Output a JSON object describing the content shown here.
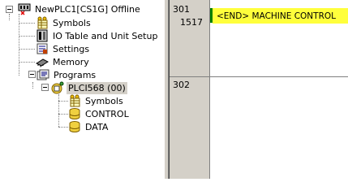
{
  "tree": {
    "root": {
      "label": "NewPLC1[CS1G] Offline",
      "icon": "plc-offline-icon"
    },
    "items": [
      {
        "label": "Symbols",
        "icon": "symbols-table-icon"
      },
      {
        "label": "IO Table and Unit Setup",
        "icon": "io-table-icon"
      },
      {
        "label": "Settings",
        "icon": "settings-icon"
      },
      {
        "label": "Memory",
        "icon": "memory-icon"
      },
      {
        "label": "Programs",
        "icon": "programs-folder-icon"
      }
    ],
    "program": {
      "label": "PLCI568 (00)",
      "icon": "program-task-icon"
    },
    "sections": [
      {
        "label": "Symbols",
        "icon": "local-symbols-icon"
      },
      {
        "label": "CONTROL",
        "icon": "section-icon"
      },
      {
        "label": "DATA",
        "icon": "section-icon"
      }
    ]
  },
  "ladder": {
    "rungs": [
      {
        "rung": "301",
        "step": "1517"
      },
      {
        "rung": "302",
        "step": ""
      }
    ],
    "end_instruction": "<END> MACHINE CONTROL"
  },
  "colors": {
    "end_highlight": "#ffff3c",
    "rail": "#008000",
    "panel": "#d4d0c8"
  }
}
